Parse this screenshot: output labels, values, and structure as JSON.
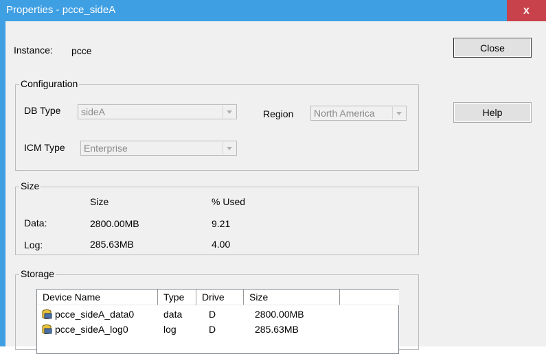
{
  "window": {
    "title": "Properties - pcce_sideA",
    "close_glyph": "x"
  },
  "instance": {
    "label": "Instance:",
    "value": "pcce"
  },
  "buttons": {
    "close": "Close",
    "help": "Help"
  },
  "configuration": {
    "legend": "Configuration",
    "db_type": {
      "label": "DB Type",
      "value": "sideA"
    },
    "region": {
      "label": "Region",
      "value": "North America"
    },
    "icm_type": {
      "label": "ICM Type",
      "value": "Enterprise"
    }
  },
  "size": {
    "legend": "Size",
    "col_size": "Size",
    "col_used": "% Used",
    "rows": [
      {
        "label": "Data:",
        "size": "2800.00MB",
        "used": "9.21"
      },
      {
        "label": "Log:",
        "size": "285.63MB",
        "used": "4.00"
      }
    ]
  },
  "storage": {
    "legend": "Storage",
    "columns": [
      "Device Name",
      "Type",
      "Drive",
      "Size"
    ],
    "rows": [
      {
        "device": "pcce_sideA_data0",
        "type": "data",
        "drive": "D",
        "size": "2800.00MB"
      },
      {
        "device": "pcce_sideA_log0",
        "type": "log",
        "drive": "D",
        "size": "285.63MB"
      }
    ]
  },
  "colors": {
    "titlebar": "#3f9fe3",
    "close": "#c7424a",
    "face": "#f0f0f0"
  }
}
